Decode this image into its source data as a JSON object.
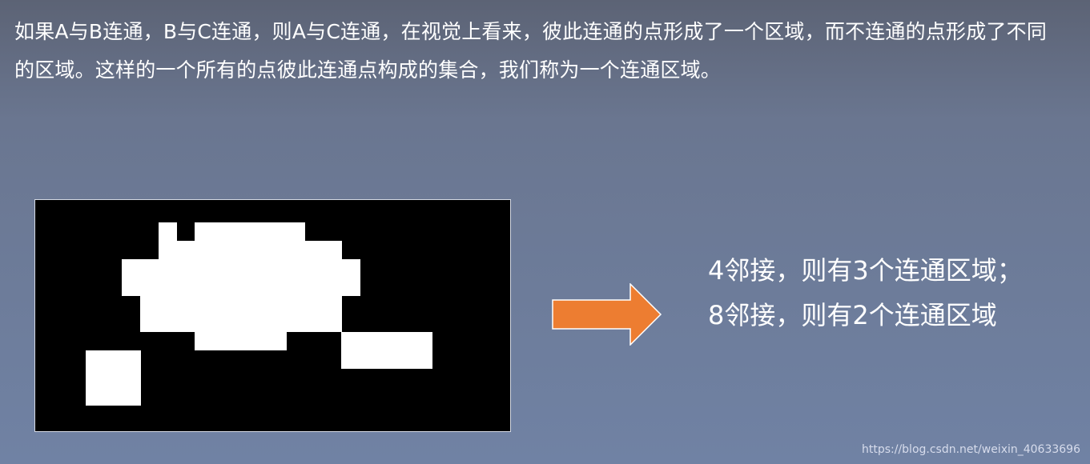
{
  "intro_text": "如果A与B连通，B与C连通，则A与C连通，在视觉上看来，彼此连通的点形成了一个区域，而不连通的点形成了不同的区域。这样的一个所有的点彼此连通点构成的集合，我们称为一个连通区域。",
  "figure": {
    "background_color": "#000000",
    "foreground_color": "#ffffff"
  },
  "arrow": {
    "icon": "right-arrow-icon",
    "fill_color": "#ed7d31",
    "stroke_color": "#ffffff"
  },
  "conclusion": {
    "line_4": "4邻接，则有3个连通区域；",
    "line_8": "8邻接，则有2个连通区域"
  },
  "watermark": "https://blog.csdn.net/weixin_40633696"
}
